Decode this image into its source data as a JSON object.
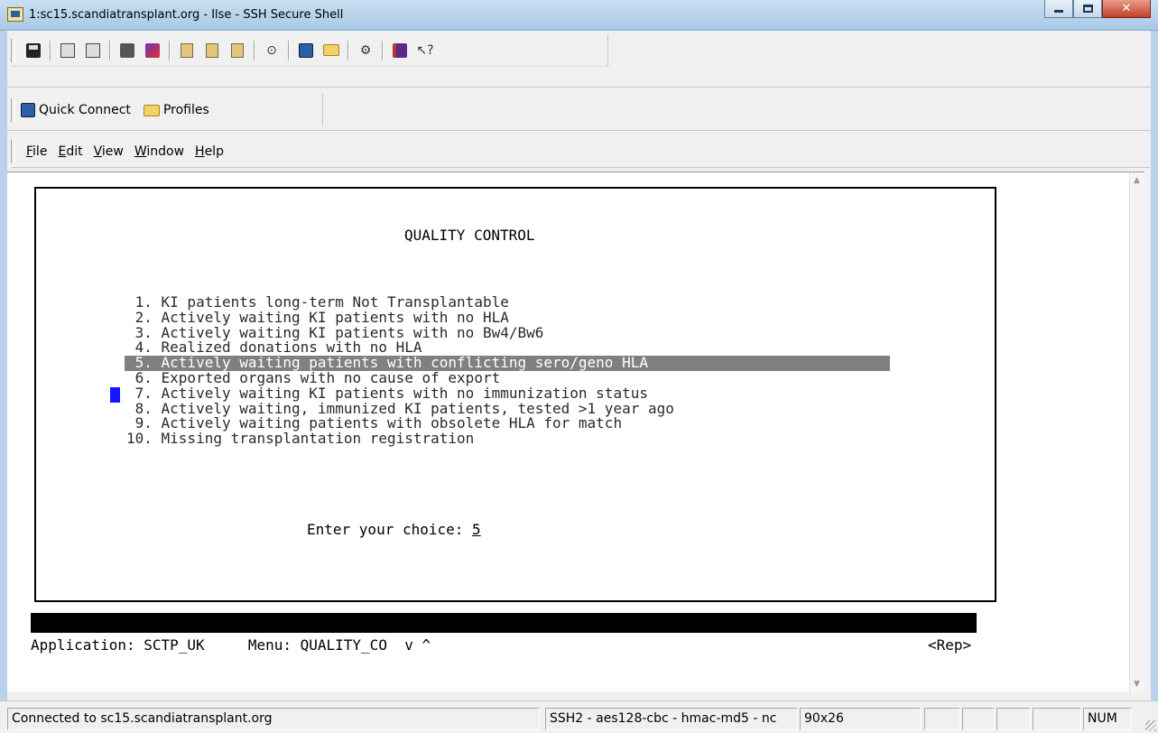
{
  "window": {
    "title": "1:sc15.scandiatransplant.org - Ilse - SSH Secure Shell"
  },
  "toolbar": {
    "icons": [
      "save-icon",
      "print-icon",
      "print-preview-icon",
      "disconnect-icon",
      "settings-icon",
      "copy-icon",
      "paste-icon",
      "paste-alt-icon",
      "find-icon",
      "new-terminal-icon",
      "new-file-transfer-icon",
      "keys-icon",
      "help-book-icon",
      "whats-this-icon"
    ]
  },
  "quickbar": {
    "quick_connect": "Quick Connect",
    "profiles": "Profiles"
  },
  "menubar": {
    "file": {
      "u": "F",
      "rest": "ile"
    },
    "edit": {
      "u": "E",
      "rest": "dit"
    },
    "view": {
      "u": "V",
      "rest": "iew"
    },
    "window": {
      "u": "W",
      "rest": "indow"
    },
    "help": {
      "u": "H",
      "rest": "elp"
    }
  },
  "terminal": {
    "title": "QUALITY CONTROL",
    "items": [
      " 1. KI patients long-term Not Transplantable",
      " 2. Actively waiting KI patients with no HLA",
      " 3. Actively waiting KI patients with no Bw4/Bw6",
      " 4. Realized donations with no HLA",
      " 5. Actively waiting patients with conflicting sero/geno HLA",
      " 6. Exported organs with no cause of export",
      " 7. Actively waiting KI patients with no immunization status",
      " 8. Actively waiting, immunized KI patients, tested >1 year ago",
      " 9. Actively waiting patients with obsolete HLA for match",
      "10. Missing transplantation registration"
    ],
    "selected_index": 4,
    "choice_label": "Enter your choice: ",
    "choice_value": "5",
    "app_line": "Application: SCTP_UK     Menu: QUALITY_CO  v ^",
    "rep": "<Rep>"
  },
  "status": {
    "connection": "Connected to sc15.scandiatransplant.org",
    "cipher": "SSH2 - aes128-cbc - hmac-md5 - nc",
    "size": "90x26",
    "num": "NUM"
  },
  "colors": {
    "title_bar": "#a9c8e6",
    "highlight": "#808080",
    "cursor": "#1515ff"
  }
}
